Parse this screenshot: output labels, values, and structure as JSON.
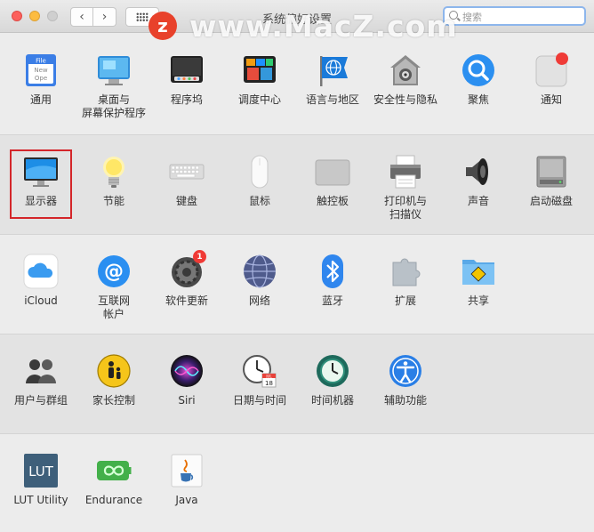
{
  "window": {
    "title": "系统偏好设置",
    "search_placeholder": "搜索",
    "nav": {
      "back": "‹",
      "forward": "›"
    }
  },
  "watermark": {
    "badge": "z",
    "text": "www.MacZ.com"
  },
  "sections": [
    {
      "items": [
        {
          "name": "general",
          "label": "通用",
          "icon": "general-icon",
          "icon_text": [
            "File",
            "New",
            "Ope"
          ]
        },
        {
          "name": "desktop",
          "label": "桌面与\n屏幕保护程序",
          "icon": "desktop-screensaver-icon"
        },
        {
          "name": "dock",
          "label": "程序坞",
          "icon": "dock-icon"
        },
        {
          "name": "mission-control",
          "label": "调度中心",
          "icon": "mission-control-icon"
        },
        {
          "name": "language",
          "label": "语言与地区",
          "icon": "language-region-icon"
        },
        {
          "name": "security",
          "label": "安全性与隐私",
          "icon": "security-privacy-icon"
        },
        {
          "name": "spotlight",
          "label": "聚焦",
          "icon": "spotlight-icon"
        },
        {
          "name": "notifications",
          "label": "通知",
          "icon": "notifications-icon"
        }
      ]
    },
    {
      "items": [
        {
          "name": "displays",
          "label": "显示器",
          "icon": "displays-icon",
          "highlighted": true
        },
        {
          "name": "energy",
          "label": "节能",
          "icon": "energy-saver-icon"
        },
        {
          "name": "keyboard",
          "label": "键盘",
          "icon": "keyboard-icon"
        },
        {
          "name": "mouse",
          "label": "鼠标",
          "icon": "mouse-icon"
        },
        {
          "name": "trackpad",
          "label": "触控板",
          "icon": "trackpad-icon"
        },
        {
          "name": "printers",
          "label": "打印机与\n扫描仪",
          "icon": "printers-scanners-icon"
        },
        {
          "name": "sound",
          "label": "声音",
          "icon": "sound-icon"
        },
        {
          "name": "startup-disk",
          "label": "启动磁盘",
          "icon": "startup-disk-icon"
        }
      ]
    },
    {
      "items": [
        {
          "name": "icloud",
          "label": "iCloud",
          "icon": "icloud-icon"
        },
        {
          "name": "internet-accounts",
          "label": "互联网\n帐户",
          "icon": "internet-accounts-icon"
        },
        {
          "name": "software-update",
          "label": "软件更新",
          "icon": "software-update-icon",
          "badge": "1"
        },
        {
          "name": "network",
          "label": "网络",
          "icon": "network-icon"
        },
        {
          "name": "bluetooth",
          "label": "蓝牙",
          "icon": "bluetooth-icon"
        },
        {
          "name": "extensions",
          "label": "扩展",
          "icon": "extensions-icon"
        },
        {
          "name": "sharing",
          "label": "共享",
          "icon": "sharing-icon"
        }
      ]
    },
    {
      "items": [
        {
          "name": "users-groups",
          "label": "用户与群组",
          "icon": "users-groups-icon"
        },
        {
          "name": "parental-controls",
          "label": "家长控制",
          "icon": "parental-controls-icon"
        },
        {
          "name": "siri",
          "label": "Siri",
          "icon": "siri-icon"
        },
        {
          "name": "date-time",
          "label": "日期与时间",
          "icon": "date-time-icon",
          "icon_text": [
            "JUL",
            "18"
          ]
        },
        {
          "name": "time-machine",
          "label": "时间机器",
          "icon": "time-machine-icon"
        },
        {
          "name": "accessibility",
          "label": "辅助功能",
          "icon": "accessibility-icon"
        }
      ]
    },
    {
      "items": [
        {
          "name": "lut-utility",
          "label": "LUT Utility",
          "icon": "lut-utility-icon",
          "icon_text": [
            "LUT"
          ]
        },
        {
          "name": "endurance",
          "label": "Endurance",
          "icon": "endurance-icon"
        },
        {
          "name": "java",
          "label": "Java",
          "icon": "java-icon"
        }
      ]
    }
  ]
}
